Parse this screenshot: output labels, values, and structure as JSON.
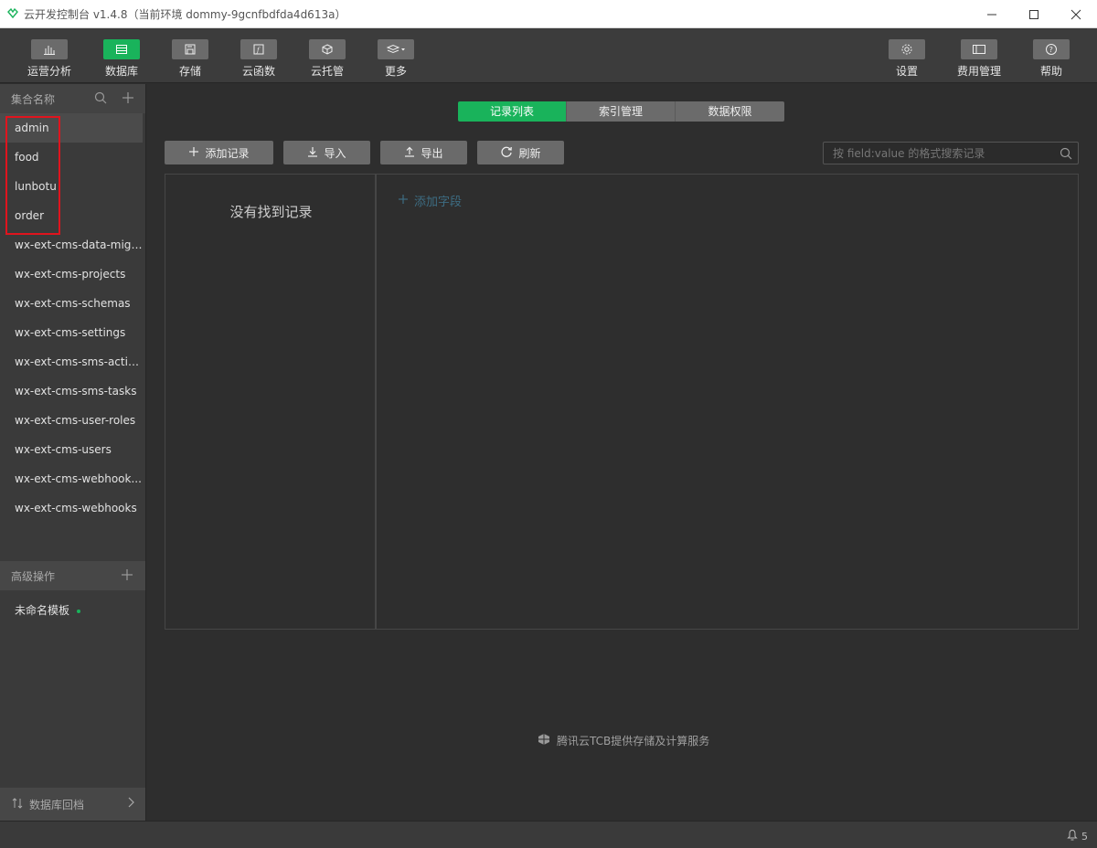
{
  "window": {
    "title": "云开发控制台 v1.4.8（当前环境 dommy-9gcnfbdfda4d613a）",
    "controls": [
      "minimize-icon",
      "maximize-icon",
      "close-icon"
    ]
  },
  "toolbar": {
    "left": [
      {
        "label": "运营分析",
        "icon": "bar-chart-icon",
        "active": false
      },
      {
        "label": "数据库",
        "icon": "database-icon",
        "active": true
      },
      {
        "label": "存储",
        "icon": "save-icon",
        "active": false
      },
      {
        "label": "云函数",
        "icon": "function-icon",
        "active": false
      },
      {
        "label": "云托管",
        "icon": "cube-icon",
        "active": false
      },
      {
        "label": "更多",
        "icon": "layers-icon",
        "active": false
      }
    ],
    "right": [
      {
        "label": "设置",
        "icon": "gear-icon"
      },
      {
        "label": "费用管理",
        "icon": "billing-icon"
      },
      {
        "label": "帮助",
        "icon": "help-icon"
      }
    ]
  },
  "sidebar": {
    "header": "集合名称",
    "collections": [
      "admin",
      "food",
      "lunbotu",
      "order",
      "wx-ext-cms-data-migr...",
      "wx-ext-cms-projects",
      "wx-ext-cms-schemas",
      "wx-ext-cms-settings",
      "wx-ext-cms-sms-activi...",
      "wx-ext-cms-sms-tasks",
      "wx-ext-cms-user-roles",
      "wx-ext-cms-users",
      "wx-ext-cms-webhook...",
      "wx-ext-cms-webhooks"
    ],
    "selected_index": 0,
    "advanced_header": "高级操作",
    "advanced_item": "未命名模板",
    "footer": "数据库回档"
  },
  "main": {
    "tabs": [
      {
        "label": "记录列表",
        "active": true
      },
      {
        "label": "索引管理",
        "active": false
      },
      {
        "label": "数据权限",
        "active": false
      }
    ],
    "actions": {
      "add": "添加记录",
      "import": "导入",
      "export": "导出",
      "refresh": "刷新"
    },
    "search_placeholder": "按 field:value 的格式搜索记录",
    "empty_text": "没有找到记录",
    "add_field": "添加字段",
    "footer_note": "腾讯云TCB提供存储及计算服务"
  },
  "statusbar": {
    "notifications": "5"
  },
  "colors": {
    "accent": "#19b35b",
    "highlight_box": "#e0141e",
    "add_field_link": "#3d6c82"
  }
}
